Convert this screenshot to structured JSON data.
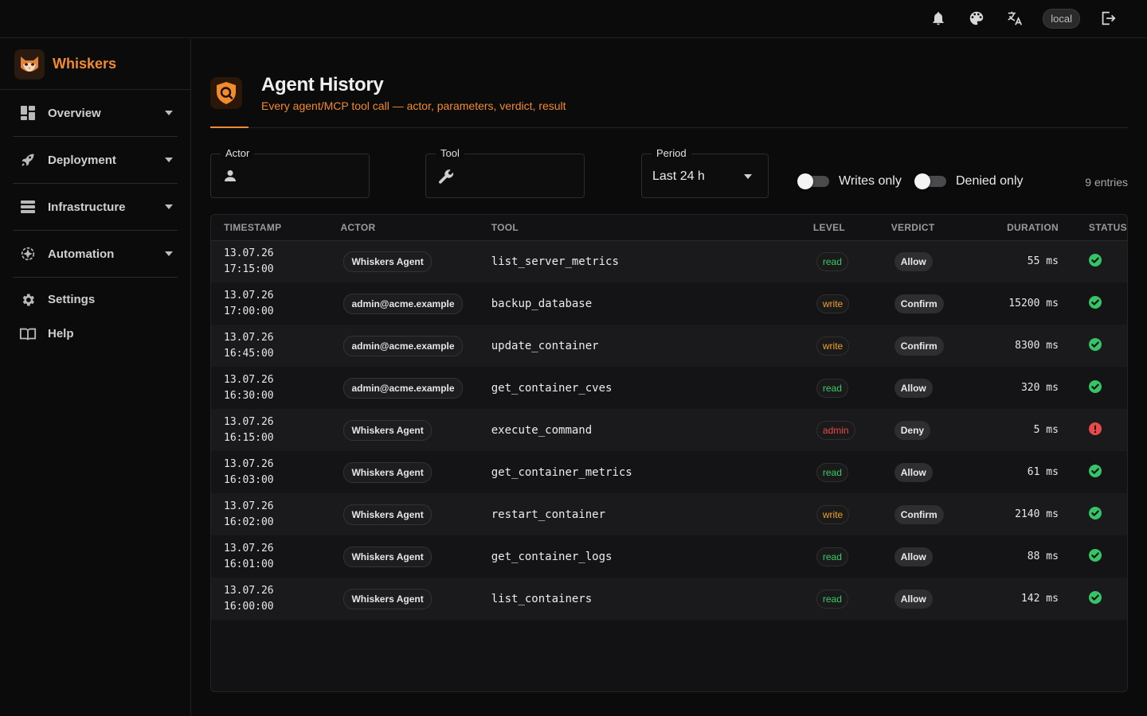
{
  "topbar": {
    "icons": [
      "bell-icon",
      "palette-icon",
      "translate-icon",
      "logout-icon"
    ],
    "env": "local"
  },
  "brand": {
    "name": "Whiskers"
  },
  "nav": [
    {
      "label": "Overview",
      "icon": "dashboard-icon",
      "expandable": true
    },
    {
      "label": "Deployment",
      "icon": "rocket-icon",
      "expandable": true
    },
    {
      "label": "Infrastructure",
      "icon": "server-icon",
      "expandable": true
    },
    {
      "label": "Automation",
      "icon": "automation-icon",
      "expandable": true
    },
    {
      "label": "Settings",
      "icon": "gear-icon",
      "expandable": false
    },
    {
      "label": "Help",
      "icon": "book-icon",
      "expandable": false
    }
  ],
  "page": {
    "title": "Agent History",
    "subtitle": "Every agent/MCP tool call — actor, parameters, verdict, result"
  },
  "filters": {
    "actor_label": "Actor",
    "tool_label": "Tool",
    "period_label": "Period",
    "period_value": "Last 24 h",
    "writes_only": "Writes only",
    "denied_only": "Denied only",
    "entries": "9 entries"
  },
  "table": {
    "columns": [
      "TIMESTAMP",
      "ACTOR",
      "TOOL",
      "LEVEL",
      "VERDICT",
      "DURATION",
      "STATUS"
    ],
    "rows": [
      {
        "date": "13.07.26",
        "time": "17:15:00",
        "actor": "Whiskers Agent",
        "tool": "list_server_metrics",
        "level": "read",
        "verdict": "Allow",
        "duration": "55 ms",
        "status": "ok"
      },
      {
        "date": "13.07.26",
        "time": "17:00:00",
        "actor": "admin@acme.example",
        "tool": "backup_database",
        "level": "write",
        "verdict": "Confirm",
        "duration": "15200 ms",
        "status": "ok"
      },
      {
        "date": "13.07.26",
        "time": "16:45:00",
        "actor": "admin@acme.example",
        "tool": "update_container",
        "level": "write",
        "verdict": "Confirm",
        "duration": "8300 ms",
        "status": "ok"
      },
      {
        "date": "13.07.26",
        "time": "16:30:00",
        "actor": "admin@acme.example",
        "tool": "get_container_cves",
        "level": "read",
        "verdict": "Allow",
        "duration": "320 ms",
        "status": "ok"
      },
      {
        "date": "13.07.26",
        "time": "16:15:00",
        "actor": "Whiskers Agent",
        "tool": "execute_command",
        "level": "admin",
        "verdict": "Deny",
        "duration": "5 ms",
        "status": "error"
      },
      {
        "date": "13.07.26",
        "time": "16:03:00",
        "actor": "Whiskers Agent",
        "tool": "get_container_metrics",
        "level": "read",
        "verdict": "Allow",
        "duration": "61 ms",
        "status": "ok"
      },
      {
        "date": "13.07.26",
        "time": "16:02:00",
        "actor": "Whiskers Agent",
        "tool": "restart_container",
        "level": "write",
        "verdict": "Confirm",
        "duration": "2140 ms",
        "status": "ok"
      },
      {
        "date": "13.07.26",
        "time": "16:01:00",
        "actor": "Whiskers Agent",
        "tool": "get_container_logs",
        "level": "read",
        "verdict": "Allow",
        "duration": "88 ms",
        "status": "ok"
      },
      {
        "date": "13.07.26",
        "time": "16:00:00",
        "actor": "Whiskers Agent",
        "tool": "list_containers",
        "level": "read",
        "verdict": "Allow",
        "duration": "142 ms",
        "status": "ok"
      }
    ]
  },
  "colors": {
    "accent": "#f28a2e",
    "ok": "#35c466",
    "error": "#e84a4a",
    "write": "#f0a030"
  }
}
